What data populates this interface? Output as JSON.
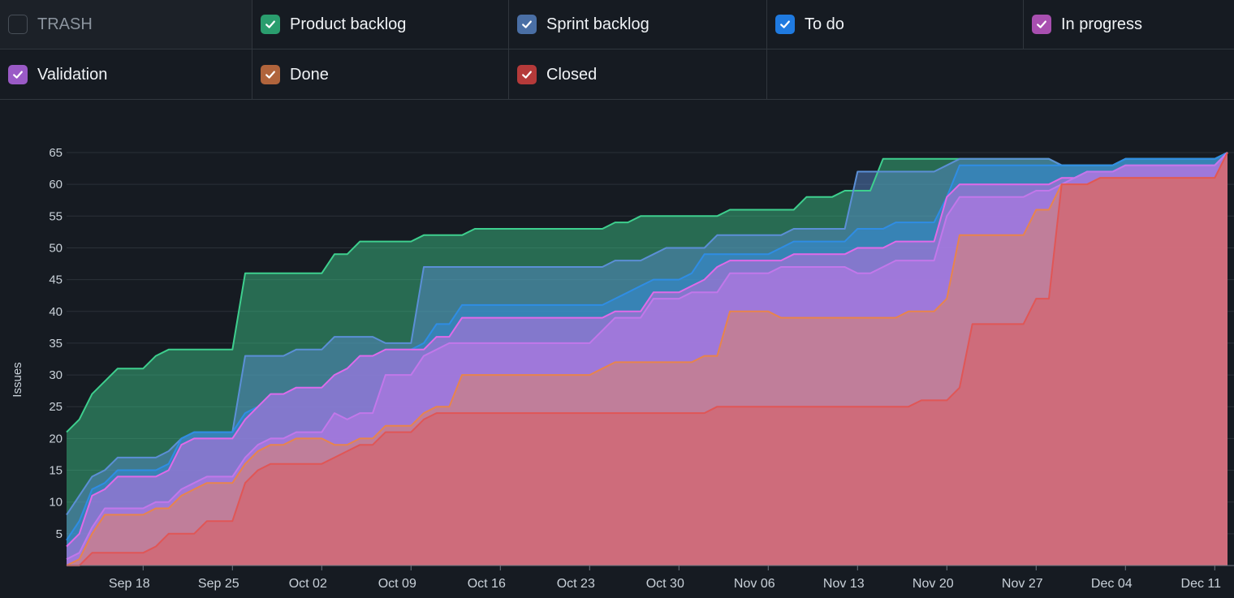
{
  "legend": [
    {
      "label": "TRASH",
      "checked": false,
      "color": "#30363d"
    },
    {
      "label": "Product backlog",
      "checked": true,
      "color": "#2a9d6e"
    },
    {
      "label": "Sprint backlog",
      "checked": true,
      "color": "#4a6fa5"
    },
    {
      "label": "To do",
      "checked": true,
      "color": "#1f7ae0"
    },
    {
      "label": "In progress",
      "checked": true,
      "color": "#a84fb0"
    },
    {
      "label": "Validation",
      "checked": true,
      "color": "#9a5ac6"
    },
    {
      "label": "Done",
      "checked": true,
      "color": "#b0643c"
    },
    {
      "label": "Closed",
      "checked": true,
      "color": "#b53a3a"
    }
  ],
  "chart_data": {
    "type": "area",
    "stacked": true,
    "title": "",
    "xlabel": "",
    "ylabel": "Issues",
    "ylim": [
      0,
      65
    ],
    "yticks": [
      5,
      10,
      15,
      20,
      25,
      30,
      35,
      40,
      45,
      50,
      55,
      60,
      65
    ],
    "xtick_labels": [
      "Sep 18",
      "Sep 25",
      "Oct 02",
      "Oct 09",
      "Oct 16",
      "Oct 23",
      "Oct 30",
      "Nov 06",
      "Nov 13",
      "Nov 20",
      "Nov 27",
      "Dec 04",
      "Dec 11"
    ],
    "xtick_days": [
      0,
      7,
      14,
      21,
      28,
      35,
      42,
      49,
      56,
      63,
      70,
      77,
      84
    ],
    "x_days": [
      -6,
      -5,
      -4,
      -3,
      -2,
      -1,
      0,
      1,
      2,
      3,
      4,
      5,
      6,
      7,
      8,
      9,
      10,
      11,
      12,
      13,
      14,
      15,
      16,
      17,
      18,
      19,
      20,
      21,
      22,
      23,
      24,
      25,
      26,
      27,
      28,
      29,
      30,
      31,
      32,
      33,
      34,
      35,
      36,
      37,
      38,
      39,
      40,
      41,
      42,
      43,
      44,
      45,
      46,
      47,
      48,
      49,
      50,
      51,
      52,
      53,
      54,
      55,
      56,
      57,
      58,
      59,
      60,
      61,
      62,
      63,
      64,
      65,
      66,
      67,
      68,
      69,
      70,
      71,
      72,
      73,
      74,
      75,
      76,
      77,
      78,
      79,
      80,
      81,
      82,
      83,
      84,
      85
    ],
    "series": [
      {
        "name": "Closed",
        "color": "#e05656",
        "values": [
          0,
          0,
          2,
          2,
          2,
          2,
          2,
          3,
          5,
          5,
          5,
          7,
          7,
          7,
          13,
          15,
          16,
          16,
          16,
          16,
          16,
          17,
          18,
          19,
          19,
          21,
          21,
          21,
          23,
          24,
          24,
          24,
          24,
          24,
          24,
          24,
          24,
          24,
          24,
          24,
          24,
          24,
          24,
          24,
          24,
          24,
          24,
          24,
          24,
          24,
          24,
          25,
          25,
          25,
          25,
          25,
          25,
          25,
          25,
          25,
          25,
          25,
          25,
          25,
          25,
          25,
          25,
          26,
          26,
          26,
          28,
          38,
          38,
          38,
          38,
          38,
          42,
          42,
          60,
          60,
          60,
          61,
          61,
          61,
          61,
          61,
          61,
          61,
          61,
          61,
          61,
          65
        ]
      },
      {
        "name": "Done",
        "color": "#e8844c",
        "values": [
          0,
          1,
          5,
          8,
          8,
          8,
          8,
          9,
          9,
          11,
          12,
          13,
          13,
          13,
          16,
          18,
          19,
          19,
          20,
          20,
          20,
          19,
          19,
          20,
          20,
          22,
          22,
          22,
          24,
          25,
          25,
          30,
          30,
          30,
          30,
          30,
          30,
          30,
          30,
          30,
          30,
          30,
          31,
          32,
          32,
          32,
          32,
          32,
          32,
          32,
          33,
          33,
          40,
          40,
          40,
          40,
          39,
          39,
          39,
          39,
          39,
          39,
          39,
          39,
          39,
          39,
          40,
          40,
          40,
          42,
          52,
          52,
          52,
          52,
          52,
          52,
          56,
          56,
          60,
          60,
          60,
          61,
          61,
          61,
          61,
          61,
          61,
          61,
          61,
          61,
          61,
          65
        ]
      },
      {
        "name": "Validation",
        "color": "#c277ea",
        "values": [
          1,
          2,
          6,
          9,
          9,
          9,
          9,
          10,
          10,
          12,
          13,
          14,
          14,
          14,
          17,
          19,
          20,
          20,
          21,
          21,
          21,
          24,
          23,
          24,
          24,
          30,
          30,
          30,
          33,
          34,
          35,
          35,
          35,
          35,
          35,
          35,
          35,
          35,
          35,
          35,
          35,
          35,
          37,
          39,
          39,
          39,
          42,
          42,
          42,
          43,
          43,
          43,
          46,
          46,
          46,
          46,
          47,
          47,
          47,
          47,
          47,
          47,
          46,
          46,
          47,
          48,
          48,
          48,
          48,
          55,
          58,
          58,
          58,
          58,
          58,
          58,
          59,
          59,
          60,
          61,
          62,
          62,
          62,
          63,
          63,
          63,
          63,
          63,
          63,
          63,
          63,
          65
        ]
      },
      {
        "name": "In progress",
        "color": "#e06ae8",
        "values": [
          3,
          5,
          11,
          12,
          14,
          14,
          14,
          14,
          15,
          19,
          20,
          20,
          20,
          20,
          23,
          25,
          27,
          27,
          28,
          28,
          28,
          30,
          31,
          33,
          33,
          34,
          34,
          34,
          34,
          36,
          36,
          39,
          39,
          39,
          39,
          39,
          39,
          39,
          39,
          39,
          39,
          39,
          39,
          40,
          40,
          40,
          43,
          43,
          43,
          44,
          45,
          47,
          48,
          48,
          48,
          48,
          48,
          49,
          49,
          49,
          49,
          49,
          50,
          50,
          50,
          51,
          51,
          51,
          51,
          58,
          60,
          60,
          60,
          60,
          60,
          60,
          60,
          60,
          61,
          61,
          62,
          62,
          62,
          63,
          63,
          63,
          63,
          63,
          63,
          63,
          63,
          65
        ]
      },
      {
        "name": "To do",
        "color": "#2f8de4",
        "values": [
          4,
          7,
          12,
          13,
          15,
          15,
          15,
          15,
          16,
          20,
          21,
          21,
          21,
          21,
          24,
          25,
          27,
          27,
          28,
          28,
          28,
          30,
          31,
          33,
          33,
          34,
          34,
          34,
          35,
          38,
          38,
          41,
          41,
          41,
          41,
          41,
          41,
          41,
          41,
          41,
          41,
          41,
          41,
          42,
          43,
          44,
          45,
          45,
          45,
          46,
          49,
          49,
          49,
          49,
          49,
          49,
          50,
          51,
          51,
          51,
          51,
          51,
          53,
          53,
          53,
          54,
          54,
          54,
          54,
          58,
          63,
          63,
          63,
          63,
          63,
          63,
          63,
          63,
          63,
          63,
          63,
          63,
          63,
          64,
          64,
          64,
          64,
          64,
          64,
          64,
          64,
          65
        ]
      },
      {
        "name": "Sprint backlog",
        "color": "#5b8fd6",
        "values": [
          8,
          11,
          14,
          15,
          17,
          17,
          17,
          17,
          18,
          20,
          21,
          21,
          21,
          21,
          33,
          33,
          33,
          33,
          34,
          34,
          34,
          36,
          36,
          36,
          36,
          35,
          35,
          35,
          47,
          47,
          47,
          47,
          47,
          47,
          47,
          47,
          47,
          47,
          47,
          47,
          47,
          47,
          47,
          48,
          48,
          48,
          49,
          50,
          50,
          50,
          50,
          52,
          52,
          52,
          52,
          52,
          52,
          53,
          53,
          53,
          53,
          53,
          62,
          62,
          62,
          62,
          62,
          62,
          62,
          63,
          64,
          64,
          64,
          64,
          64,
          64,
          64,
          64,
          63,
          63,
          63,
          63,
          63,
          64,
          64,
          64,
          64,
          64,
          64,
          64,
          64,
          65
        ]
      },
      {
        "name": "Product backlog",
        "color": "#3ecf8e",
        "values": [
          21,
          23,
          27,
          29,
          31,
          31,
          31,
          33,
          34,
          34,
          34,
          34,
          34,
          34,
          46,
          46,
          46,
          46,
          46,
          46,
          46,
          49,
          49,
          51,
          51,
          51,
          51,
          51,
          52,
          52,
          52,
          52,
          53,
          53,
          53,
          53,
          53,
          53,
          53,
          53,
          53,
          53,
          53,
          54,
          54,
          55,
          55,
          55,
          55,
          55,
          55,
          55,
          56,
          56,
          56,
          56,
          56,
          56,
          58,
          58,
          58,
          59,
          59,
          59,
          64,
          64,
          64,
          64,
          64,
          64,
          64,
          64,
          64,
          64,
          64,
          64,
          64,
          64,
          63,
          63,
          63,
          63,
          63,
          64,
          64,
          64,
          64,
          64,
          64,
          64,
          64,
          65
        ]
      }
    ]
  }
}
